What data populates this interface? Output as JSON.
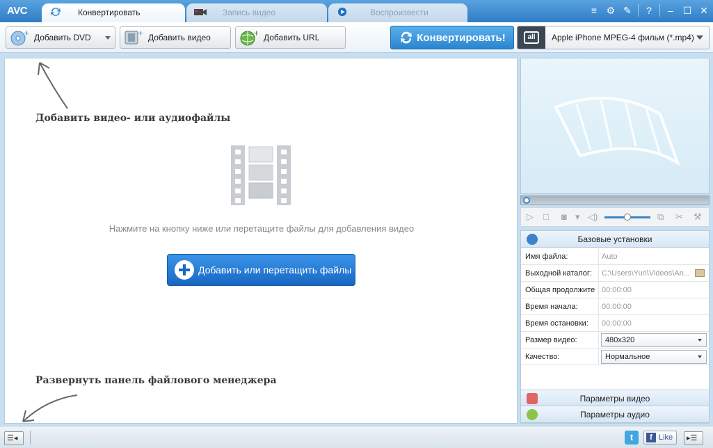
{
  "app": {
    "logo": "AVC"
  },
  "tabs": [
    {
      "label": "Конвертировать",
      "active": true
    },
    {
      "label": "Запись видео",
      "active": false
    },
    {
      "label": "Воспроизвести",
      "active": false
    }
  ],
  "window_icons": [
    "menu-icon",
    "gear-icon",
    "wrench-icon",
    "help-icon",
    "minimize-icon",
    "maximize-icon",
    "close-icon"
  ],
  "toolbar": {
    "add_dvd": "Добавить DVD",
    "add_video": "Добавить видео",
    "add_url": "Добавить URL",
    "convert": "Конвертировать!",
    "profile_icon_text": "all",
    "profile": "Apple iPhone MPEG-4 фильм (*.mp4)"
  },
  "main": {
    "hint_add": "Добавить видео- или аудиофайлы",
    "drop_text": "Нажмите на кнопку ниже или перетащите файлы для добавления видео",
    "add_files_button": "Добавить или перетащить файлы",
    "hint_expand": "Развернуть панель файлового менеджера"
  },
  "player": {
    "seek_position": 0,
    "volume_level": 0.45
  },
  "settings": {
    "basic_header": "Базовые установки",
    "rows": [
      {
        "label": "Имя файла:",
        "value": "Auto"
      },
      {
        "label": "Выходной каталог:",
        "value": "C:\\Users\\Yuri\\Videos\\An..."
      },
      {
        "label": "Общая продолжите",
        "value": "00:00:00"
      },
      {
        "label": "Время начала:",
        "value": "00:00:00"
      },
      {
        "label": "Время остановки:",
        "value": "00:00:00"
      },
      {
        "label": "Размер видео:",
        "value": "480x320"
      },
      {
        "label": "Качество:",
        "value": "Нормальное"
      }
    ],
    "video_params": "Параметры видео",
    "audio_params": "Параметры аудио"
  },
  "statusbar": {
    "twitter": "t",
    "like": "Like",
    "fb": "f"
  },
  "colors": {
    "accent": "#2a85cf",
    "titlebar": "#3f8fd4"
  }
}
